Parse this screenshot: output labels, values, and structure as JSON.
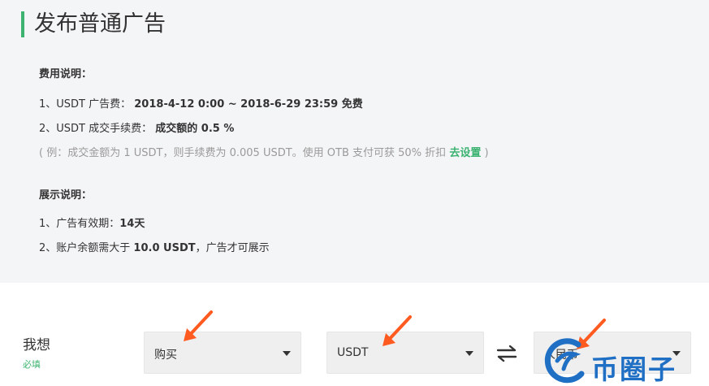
{
  "page_title": "发布普通广告",
  "fees": {
    "heading": "费用说明：",
    "ad_fee_label": "1、USDT 广告费：",
    "ad_fee_value": "2018-4-12 0:00 ~ 2018-6-29 23:59 免费",
    "trade_fee_label": "2、USDT 成交手续费：",
    "trade_fee_value": "成交额的 0.5 %",
    "example_text": "( 例：成交金额为 1 USDT，则手续费为 0.005 USDT。使用 OTB 支付可获 50% 折扣",
    "example_link": "去设置",
    "example_close": ")"
  },
  "display": {
    "heading": "展示说明：",
    "validity_label": "1、广告有效期：",
    "validity_value": "14天",
    "balance_prefix": "2、账户余额需大于",
    "balance_value": "10.0 USDT",
    "balance_suffix": "，广告才可展示"
  },
  "form": {
    "label": "我想",
    "required": "必填",
    "action_select": "购买",
    "coin_select": "USDT",
    "currency_select": "人民币"
  },
  "watermark": {
    "text": "币圈子"
  },
  "colors": {
    "accent_green": "#3cb371",
    "arrow_orange": "#ff5a1f",
    "watermark_blue": "#1f6fc4"
  },
  "icons": {
    "swap": "swap-icon",
    "caret": "chevron-down-icon"
  }
}
